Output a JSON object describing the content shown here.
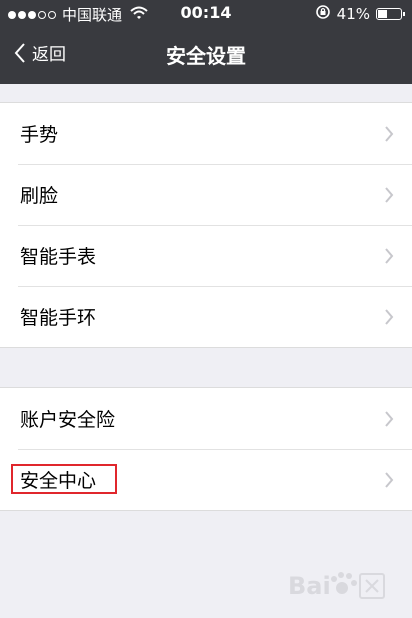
{
  "status_bar": {
    "carrier": "中国联通",
    "time": "00:14",
    "battery_percent_label": "41%",
    "battery_level": 0.41,
    "signal_bars_filled": 3,
    "signal_bars_total": 5
  },
  "nav": {
    "back_label": "返回",
    "title": "安全设置"
  },
  "groups": [
    {
      "items": [
        {
          "label": "手势"
        },
        {
          "label": "刷脸"
        },
        {
          "label": "智能手表"
        },
        {
          "label": "智能手环"
        }
      ]
    },
    {
      "items": [
        {
          "label": "账户安全险"
        },
        {
          "label": "安全中心",
          "highlighted": true
        }
      ]
    }
  ],
  "colors": {
    "header_bg": "#393a3f",
    "page_bg": "#efeff4",
    "highlight_border": "#e0262c"
  },
  "icons": {
    "back": "chevron-left-icon",
    "row_arrow": "chevron-right-icon",
    "wifi": "wifi-icon",
    "rotation_lock": "rotation-lock-icon",
    "battery": "battery-icon",
    "watermark": "baidu-jingyan-watermark"
  }
}
